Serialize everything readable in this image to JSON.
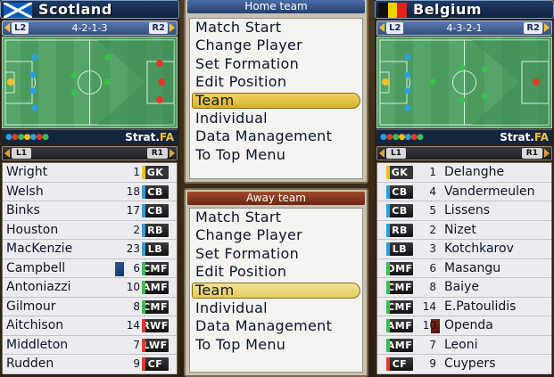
{
  "home": {
    "team_name": "Scotland",
    "flag": "scotland-flag",
    "formation_label": "4-2-1-3",
    "formation_left_slot": "L2",
    "formation_right_slot": "R2",
    "strategy_label": "Strat.",
    "strategy_value": "FA",
    "list_left_slot": "L1",
    "list_right_slot": "R1",
    "players": [
      {
        "name": "Wright",
        "number": "1",
        "position": "GK"
      },
      {
        "name": "Welsh",
        "number": "18",
        "position": "CB"
      },
      {
        "name": "Binks",
        "number": "17",
        "position": "CB"
      },
      {
        "name": "Houston",
        "number": "2",
        "position": "RB"
      },
      {
        "name": "MacKenzie",
        "number": "23",
        "position": "LB"
      },
      {
        "name": "Campbell",
        "number": "6",
        "position": "CMF"
      },
      {
        "name": "Antoniazzi",
        "number": "10",
        "position": "AMF"
      },
      {
        "name": "Gilmour",
        "number": "8",
        "position": "CMF"
      },
      {
        "name": "Aitchison",
        "number": "14",
        "position": "RWF"
      },
      {
        "name": "Middleton",
        "number": "7",
        "position": "LWF"
      },
      {
        "name": "Rudden",
        "number": "9",
        "position": "CF"
      }
    ]
  },
  "away": {
    "team_name": "Belgium",
    "flag": "belgium-flag",
    "formation_label": "4-3-2-1",
    "formation_left_slot": "L2",
    "formation_right_slot": "R2",
    "strategy_label": "Strat.",
    "strategy_value": "FA",
    "list_left_slot": "L1",
    "list_right_slot": "R1",
    "players": [
      {
        "name": "Delanghe",
        "number": "1",
        "position": "GK"
      },
      {
        "name": "Vandermeulen",
        "number": "4",
        "position": "CB"
      },
      {
        "name": "Lissens",
        "number": "5",
        "position": "CB"
      },
      {
        "name": "Nizet",
        "number": "2",
        "position": "RB"
      },
      {
        "name": "Kotchkarov",
        "number": "3",
        "position": "LB"
      },
      {
        "name": "Masangu",
        "number": "6",
        "position": "DMF"
      },
      {
        "name": "Baiye",
        "number": "8",
        "position": "CMF"
      },
      {
        "name": "E.Patoulidis",
        "number": "14",
        "position": "CMF"
      },
      {
        "name": "Openda",
        "number": "10",
        "position": "AMF"
      },
      {
        "name": "Leoni",
        "number": "7",
        "position": "AMF"
      },
      {
        "name": "Cuypers",
        "number": "9",
        "position": "CF"
      }
    ]
  },
  "home_menu": {
    "title": "Home team",
    "items": [
      "Match Start",
      "Change Player",
      "Set Formation",
      "Edit Position",
      "Team",
      "Individual",
      "Data Management",
      "To Top Menu"
    ],
    "selected_index": 4
  },
  "away_menu": {
    "title": "Away team",
    "items": [
      "Match Start",
      "Change Player",
      "Set Formation",
      "Edit Position",
      "Team",
      "Individual",
      "Data Management",
      "To Top Menu"
    ],
    "selected_index": 4
  },
  "colors": {
    "gk": "#f2c01e",
    "def": "#2aa0e0",
    "mid": "#3bc04a",
    "fwd": "#e23a2a",
    "accent_gold": "#f4c430"
  }
}
